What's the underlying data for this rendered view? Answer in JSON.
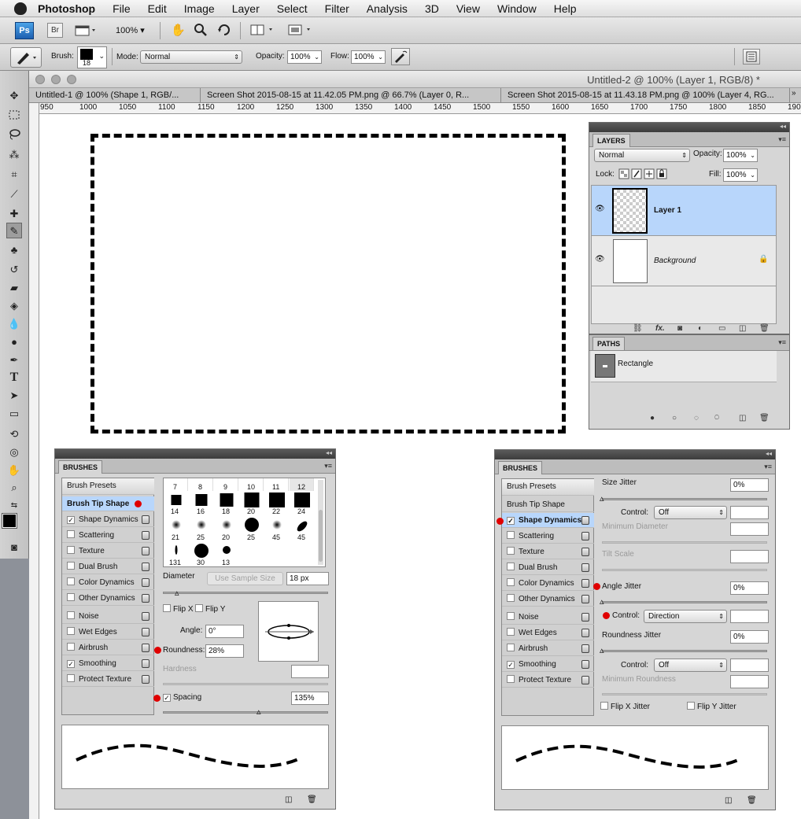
{
  "menubar": {
    "app_name": "Photoshop",
    "items": [
      "File",
      "Edit",
      "Image",
      "Layer",
      "Select",
      "Filter",
      "Analysis",
      "3D",
      "View",
      "Window",
      "Help"
    ]
  },
  "app_bar": {
    "ps_label": "Ps",
    "br_label": "Br",
    "zoom": "100%"
  },
  "options_bar": {
    "brush_label": "Brush:",
    "brush_size": "18",
    "mode_label": "Mode:",
    "mode_value": "Normal",
    "opacity_label": "Opacity:",
    "opacity_value": "100%",
    "flow_label": "Flow:",
    "flow_value": "100%"
  },
  "document": {
    "window_title": "Untitled-2 @ 100% (Layer 1, RGB/8) *",
    "tabs": [
      "Untitled-1 @ 100% (Shape 1, RGB/...",
      "Screen Shot 2015-08-15 at 11.42.05 PM.png @ 66.7% (Layer 0, R...",
      "Screen Shot 2015-08-15 at 11.43.18 PM.png @ 100% (Layer 4, RG..."
    ],
    "ruler_labels": [
      "950",
      "1000",
      "1050",
      "1100",
      "1150",
      "1200",
      "1250",
      "1300",
      "1350",
      "1400",
      "1450",
      "1500",
      "1550",
      "1600",
      "1650",
      "1700",
      "1750",
      "1800",
      "1850",
      "1900"
    ]
  },
  "layers_panel": {
    "tab": "LAYERS",
    "blend_mode": "Normal",
    "opacity_label": "Opacity:",
    "opacity_value": "100%",
    "lock_label": "Lock:",
    "fill_label": "Fill:",
    "fill_value": "100%",
    "layers": [
      {
        "name": "Layer 1",
        "selected": true
      },
      {
        "name": "Background",
        "selected": false
      }
    ]
  },
  "paths_panel": {
    "tab": "PATHS",
    "paths": [
      {
        "name": "Rectangle"
      }
    ]
  },
  "brushes_left": {
    "tab": "BRUSHES",
    "presets_button": "Brush Presets",
    "options": [
      {
        "label": "Brush Tip Shape",
        "checked": null,
        "selected": true
      },
      {
        "label": "Shape Dynamics",
        "checked": true
      },
      {
        "label": "Scattering",
        "checked": false
      },
      {
        "label": "Texture",
        "checked": false
      },
      {
        "label": "Dual Brush",
        "checked": false
      },
      {
        "label": "Color Dynamics",
        "checked": false
      },
      {
        "label": "Other Dynamics",
        "checked": false
      },
      {
        "label": "Noise",
        "checked": false
      },
      {
        "label": "Wet Edges",
        "checked": false
      },
      {
        "label": "Airbrush",
        "checked": false
      },
      {
        "label": "Smoothing",
        "checked": true
      },
      {
        "label": "Protect Texture",
        "checked": false
      }
    ],
    "tip_top_row": [
      "7",
      "8",
      "9",
      "10",
      "11",
      "12"
    ],
    "tips": [
      {
        "size": "14"
      },
      {
        "size": "16"
      },
      {
        "size": "18"
      },
      {
        "size": "20"
      },
      {
        "size": "22"
      },
      {
        "size": "24"
      },
      {
        "size": "21"
      },
      {
        "size": "25"
      },
      {
        "size": "20"
      },
      {
        "size": "25"
      },
      {
        "size": "45"
      },
      {
        "size": "45"
      },
      {
        "size": "131"
      },
      {
        "size": "30"
      },
      {
        "size": "13"
      }
    ],
    "diameter_label": "Diameter",
    "use_sample_size": "Use Sample Size",
    "diameter_value": "18 px",
    "flip_x": "Flip X",
    "flip_y": "Flip Y",
    "angle_label": "Angle:",
    "angle_value": "0°",
    "roundness_label": "Roundness:",
    "roundness_value": "28%",
    "hardness_label": "Hardness",
    "spacing_label": "Spacing",
    "spacing_value": "135%"
  },
  "brushes_right": {
    "tab": "BRUSHES",
    "presets_button": "Brush Presets",
    "options": [
      {
        "label": "Brush Tip Shape",
        "checked": null,
        "selected": false
      },
      {
        "label": "Shape Dynamics",
        "checked": true,
        "selected": true
      },
      {
        "label": "Scattering",
        "checked": false
      },
      {
        "label": "Texture",
        "checked": false
      },
      {
        "label": "Dual Brush",
        "checked": false
      },
      {
        "label": "Color Dynamics",
        "checked": false
      },
      {
        "label": "Other Dynamics",
        "checked": false
      },
      {
        "label": "Noise",
        "checked": false
      },
      {
        "label": "Wet Edges",
        "checked": false
      },
      {
        "label": "Airbrush",
        "checked": false
      },
      {
        "label": "Smoothing",
        "checked": true
      },
      {
        "label": "Protect Texture",
        "checked": false
      }
    ],
    "size_jitter_label": "Size Jitter",
    "size_jitter_value": "0%",
    "control_label": "Control:",
    "control_size": "Off",
    "min_diameter_label": "Minimum Diameter",
    "tilt_scale_label": "Tilt Scale",
    "angle_jitter_label": "Angle Jitter",
    "angle_jitter_value": "0%",
    "control_angle": "Direction",
    "roundness_jitter_label": "Roundness Jitter",
    "roundness_jitter_value": "0%",
    "control_roundness": "Off",
    "min_roundness_label": "Minimum Roundness",
    "flip_x_jitter": "Flip X Jitter",
    "flip_y_jitter": "Flip Y Jitter"
  }
}
